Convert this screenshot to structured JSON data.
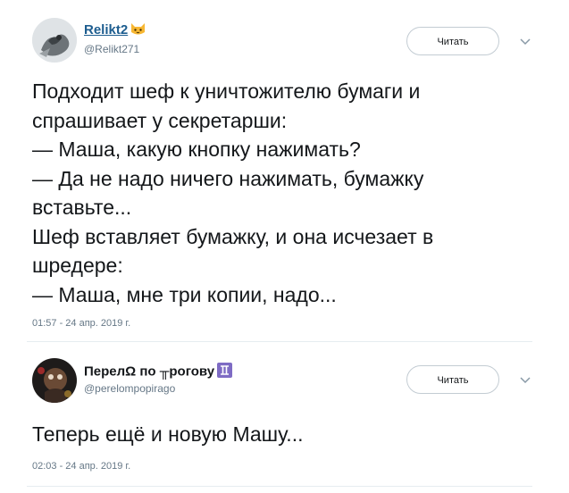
{
  "tweets": [
    {
      "author_name": "Relikt2",
      "author_handle": "@Relikt271",
      "follow_label": "Читать",
      "lines": [
        "Подходит шеф к уничтожителю бумаги и",
        "спрашивает у секретарши:",
        "— Маша, какую кнопку нажимать?",
        "— Да не надо ничего нажимать, бумажку",
        "вставьте...",
        "Шеф вставляет бумажку, и она исчезает в",
        "шредере:",
        "— Маша, мне три копии, надо..."
      ],
      "timestamp": "01:57 - 24 апр. 2019 г.",
      "name_emoji": "cat-face-icon"
    },
    {
      "author_name": "ПерелΩ по ╥рогову",
      "author_handle": "@perelompopirago",
      "follow_label": "Читать",
      "lines": [
        "Теперь ещё и новую Машу..."
      ],
      "timestamp": "02:03 - 24 апр. 2019 г.",
      "name_emoji": "gemini-icon"
    }
  ],
  "colors": {
    "link": "#1d5d8f",
    "muted": "#657786",
    "text": "#14171a",
    "border": "#c3ccd3",
    "gemini": "#7e6bc4",
    "cat": "#f7b733"
  }
}
